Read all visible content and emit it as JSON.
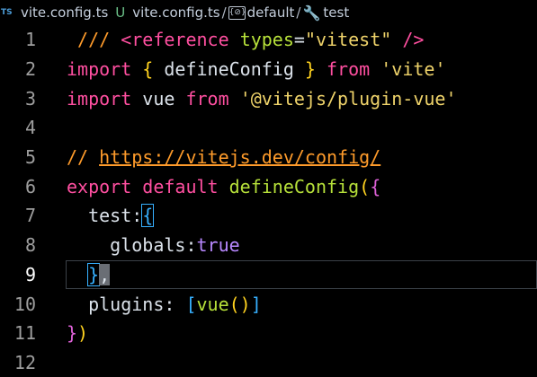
{
  "breadcrumb": {
    "lang_badge": "TS",
    "file_name": "vite.config.ts",
    "git_status": "U",
    "path_file": "vite.config.ts",
    "separator": "/",
    "module_icon_text": "{⊘}",
    "path_default": "default",
    "wrench_icon": "🔧",
    "path_test": "test"
  },
  "editor": {
    "active_line": 9,
    "line_numbers": [
      "1",
      "2",
      "3",
      "4",
      "5",
      "6",
      "7",
      "8",
      "9",
      "10",
      "11",
      "12"
    ],
    "lines": {
      "l1": [
        " ",
        "/// ",
        "<reference",
        " ",
        "types",
        "=",
        "\"vitest\"",
        " ",
        "/>"
      ],
      "l2": [
        "import",
        " ",
        "{",
        " defineConfig ",
        "}",
        " ",
        "from",
        " ",
        "'vite'"
      ],
      "l3": [
        "import",
        " vue ",
        "from",
        " ",
        "'@vitejs/plugin-vue'"
      ],
      "l5": [
        "// ",
        "https://vitejs.dev/config/"
      ],
      "l6": [
        "export",
        " ",
        "default",
        " ",
        "defineConfig",
        "(",
        "{"
      ],
      "l7": [
        "  test:",
        "{"
      ],
      "l8": [
        "    globals:",
        "true"
      ],
      "l9": [
        "  ",
        "}",
        ","
      ],
      "l10": [
        "  plugins: ",
        "[",
        "vue",
        "(",
        ")",
        "]"
      ],
      "l11": [
        "}",
        ")"
      ]
    }
  },
  "colors": {
    "background": "#000000",
    "keyword": "#ff4fa0",
    "function": "#b7e13a",
    "string": "#efd36a",
    "comment": "#fe9b2b",
    "bracket_level1": "#ffd21f",
    "bracket_level2": "#de61d8",
    "bracket_level3": "#36b0ff",
    "boolean": "#b888ff"
  }
}
